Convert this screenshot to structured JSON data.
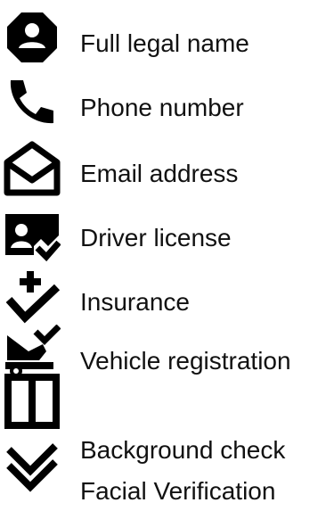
{
  "items": [
    {
      "label": "Full legal name",
      "icon": "person-badge-icon"
    },
    {
      "label": "Phone number",
      "icon": "phone-icon"
    },
    {
      "label": "Email address",
      "icon": "open-envelope-icon"
    },
    {
      "label": "Driver license",
      "icon": "id-card-check-icon"
    },
    {
      "label": "Insurance",
      "icon": "plus-check-icon"
    },
    {
      "label": "Vehicle registration",
      "icon": "car-seat-check-icon"
    },
    {
      "label": "Background check",
      "icon": "split-square-icon"
    },
    {
      "label": "Facial Verification",
      "icon": "double-check-icon"
    }
  ],
  "colors": {
    "icon": "#000000",
    "text": "#111111",
    "background": "#ffffff"
  }
}
